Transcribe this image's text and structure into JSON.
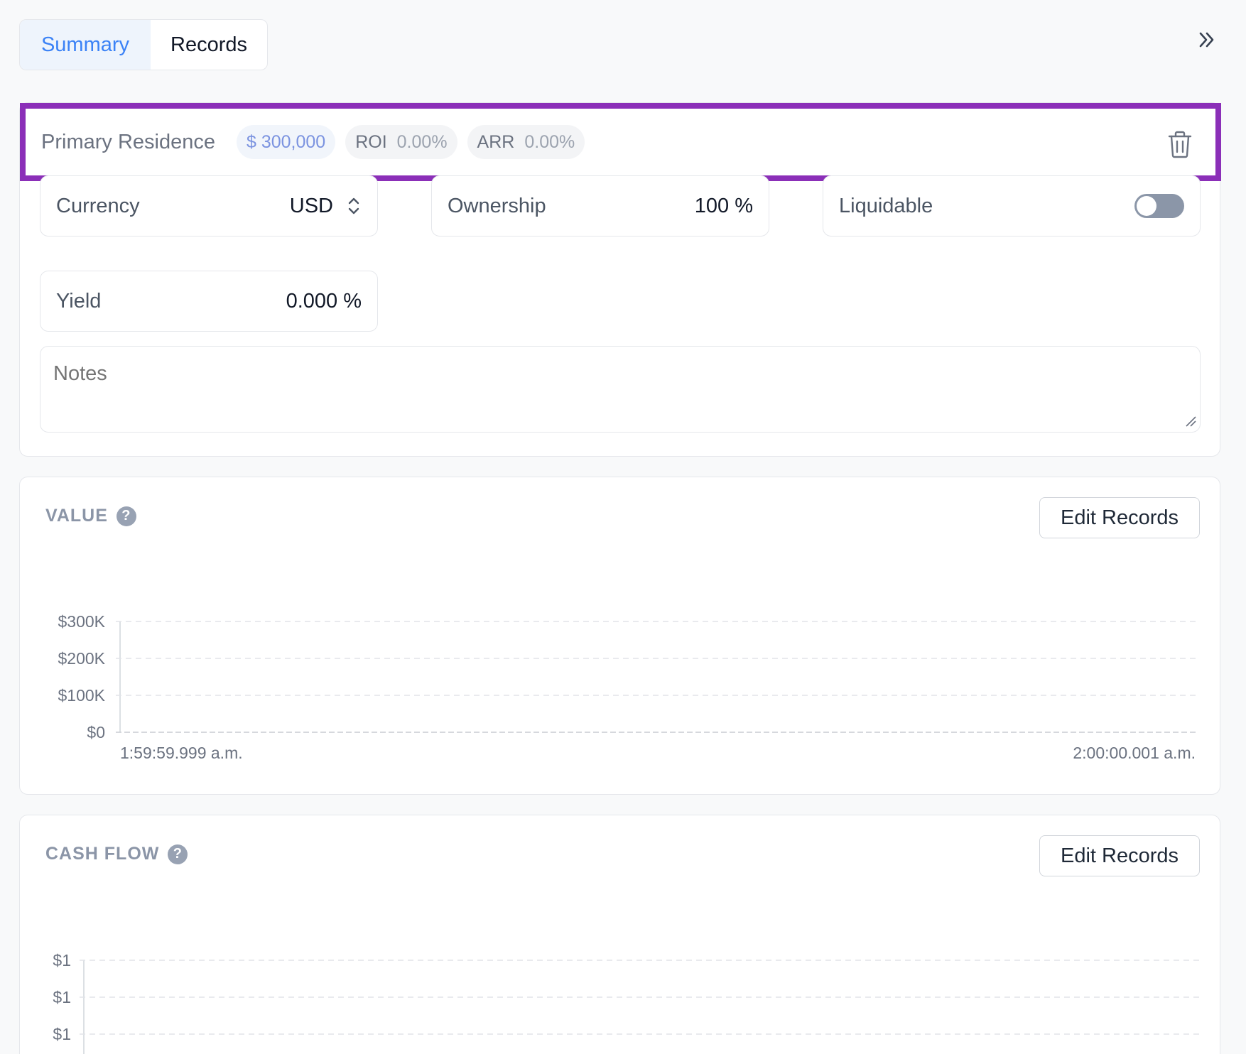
{
  "tabs": [
    {
      "label": "Summary",
      "active": true
    },
    {
      "label": "Records",
      "active": false
    }
  ],
  "asset": {
    "name": "Primary Residence",
    "amount": "$ 300,000",
    "roi_label": "ROI",
    "roi_value": "0.00%",
    "arr_label": "ARR",
    "arr_value": "0.00%"
  },
  "fields": {
    "currency_label": "Currency",
    "currency_value": "USD",
    "ownership_label": "Ownership",
    "ownership_value": "100 %",
    "liquidable_label": "Liquidable",
    "liquidable_on": false,
    "yield_label": "Yield",
    "yield_value": "0.000 %",
    "notes_placeholder": "Notes"
  },
  "value_section": {
    "title": "VALUE",
    "help": "?",
    "edit_button": "Edit Records"
  },
  "cash_section": {
    "title": "CASH FLOW",
    "help": "?",
    "edit_button": "Edit Records"
  },
  "chart_data": [
    {
      "type": "line",
      "title": "VALUE",
      "y_ticks": [
        "$300K",
        "$200K",
        "$100K",
        "$0"
      ],
      "ylim": [
        0,
        300000
      ],
      "x_ticks": [
        "1:59:59.999 a.m.",
        "2:00:00.001 a.m."
      ],
      "series": [],
      "grid": true
    },
    {
      "type": "line",
      "title": "CASH FLOW",
      "y_ticks": [
        "$1",
        "$1",
        "$1"
      ],
      "series": [],
      "grid": true
    }
  ],
  "colors": {
    "accent": "#3b82f6",
    "highlight_border": "#8b2fb8",
    "toggle_off": "#8b96a8"
  }
}
